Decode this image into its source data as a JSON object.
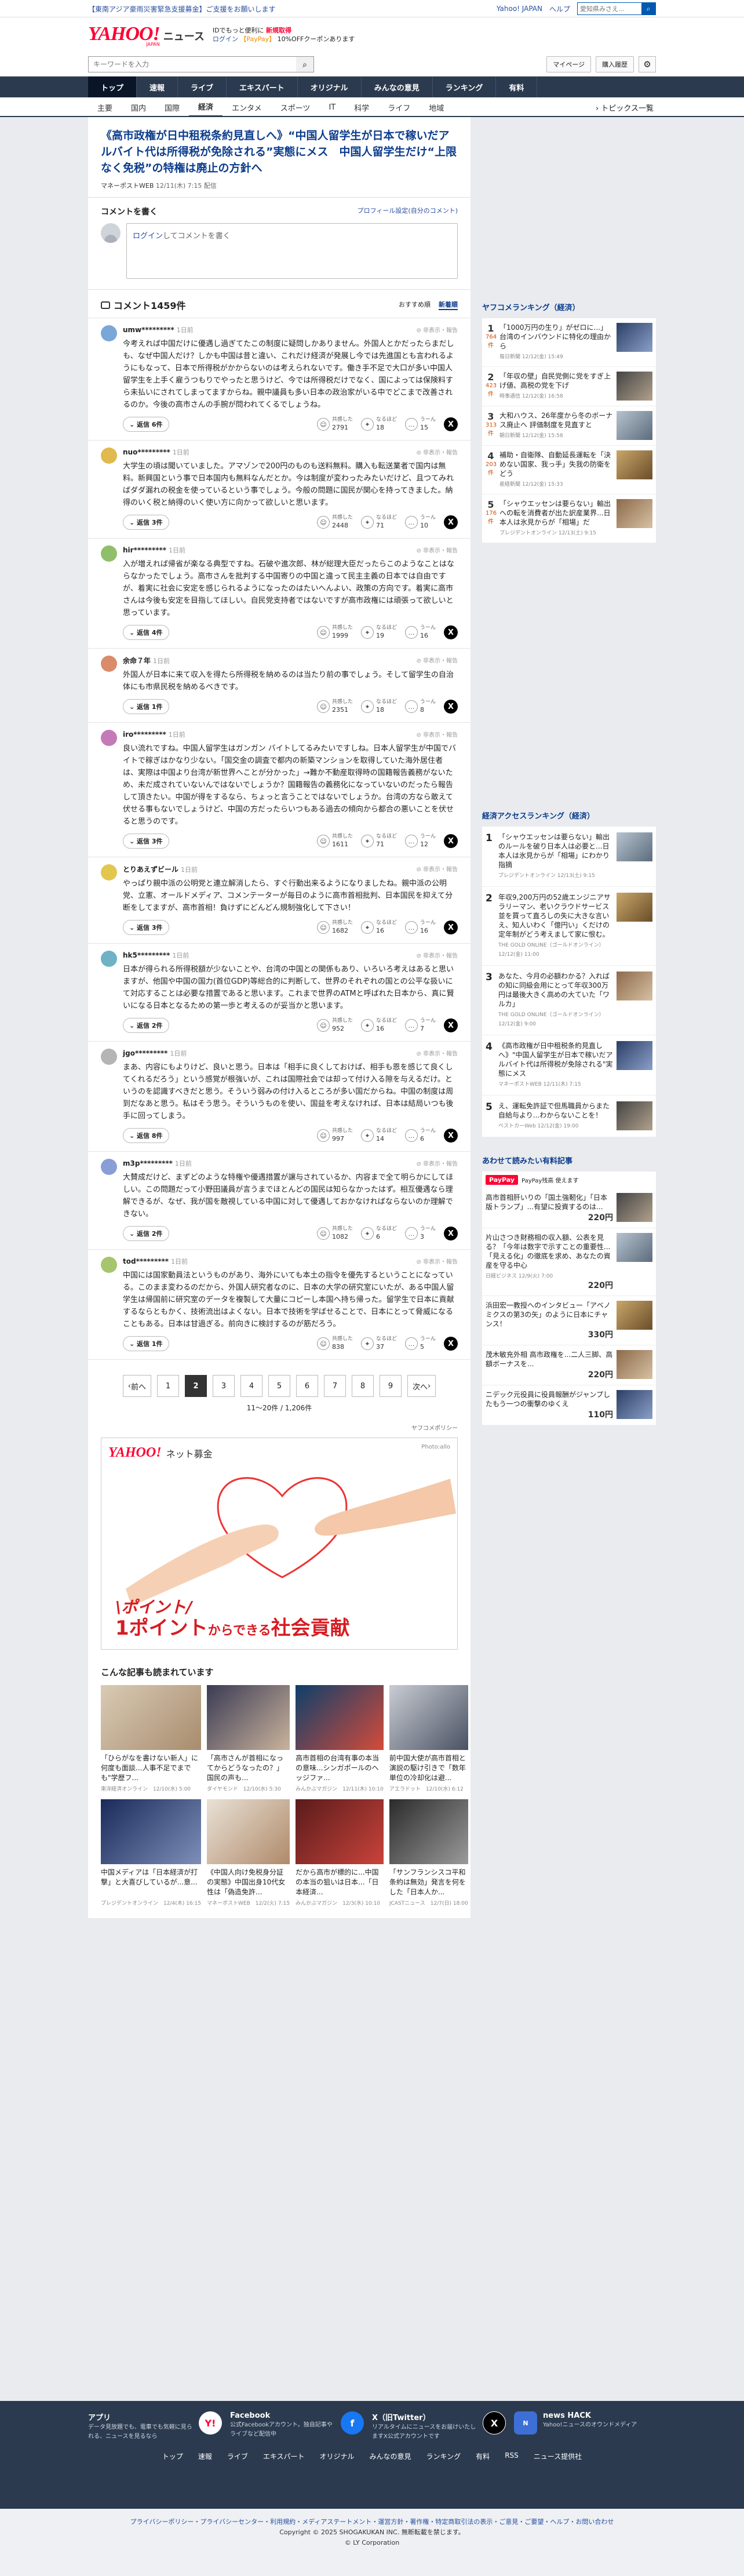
{
  "notice": {
    "text": "【東南アジア豪雨災害緊急支援募金】ご支援をお願いします",
    "links": [
      "Yahoo! JAPAN",
      "ヘルプ"
    ],
    "search_placeholder": "愛知県みさえ..."
  },
  "masthead": {
    "logo": "YAHOO!",
    "sub": "JAPAN",
    "news": "ニュース",
    "promo1": "IDでもっと便利に",
    "promo1b": "新規取得",
    "login": "ログイン",
    "pay": "【PayPay】",
    "promo2": "10%OFFクーポンあります"
  },
  "search": {
    "placeholder": "キーワードを入力",
    "mypage": "マイページ",
    "history": "購入履歴"
  },
  "gnav": [
    "トップ",
    "速報",
    "ライブ",
    "エキスパート",
    "オリジナル",
    "みんなの意見",
    "ランキング",
    "有料"
  ],
  "snav": [
    "主要",
    "国内",
    "国際",
    "経済",
    "エンタメ",
    "スポーツ",
    "IT",
    "科学",
    "ライフ",
    "地域"
  ],
  "snav_topics": "トピックス一覧",
  "article": {
    "title": "《高市政権が日中租税条約見直しへ》“中国人留学生が日本で稼いだアルバイト代は所得税が免除される”実態にメス　中国人留学生だけ“上限なく免税”の特権は廃止の方針へ",
    "source": "マネーポストWEB",
    "date": "12/11(木) 7:15 配信"
  },
  "post": {
    "title": "コメントを書く",
    "profile": "プロフィール設定(自分のコメント)",
    "login": "ログイン",
    "placeholder": "してコメントを書く"
  },
  "comments_head": {
    "title": "コメント1459件",
    "sort1": "おすすめ順",
    "sort2": "新着順"
  },
  "labels": {
    "react1": "共感した",
    "react2": "なるほど",
    "react3": "うーん",
    "control": "非表示・報告",
    "x": "X"
  },
  "comments": [
    {
      "user": "umw*********",
      "time": "1日前",
      "text": "今考えれば中国だけに優遇し過ぎてたこの制度に疑問しかありません。外国人とかだったらまだしも、なぜ中国人だけ？しかも中国は昔と違い、これだけ経済が発展し今では先進国とも言われるようにもなって、日本で所得税がかからないのは考えられないです。働き手不足で大口が多い中国人留学生を上手く雇うつもりでやったと思うけど、今では所得税だけでなく、国によっては保険料すら未払いにされてしまってますからね。親中議員も多い日本の政治家がいる中でどこまで改善されるのか。今後の高市さんの手腕が問われてくるでしょうね。",
      "replies": "返信 6件",
      "r1": "2791",
      "r2": "18",
      "r3": "15"
    },
    {
      "user": "nuo*********",
      "time": "1日前",
      "text": "大学生の頃は聞いていました。アマゾンで200円のものも送料無料。購入も転送業者で国内は無料。新興国という事で日本国内も無料なんだとか。今は制度が変わったみたいだけど、且つてみればダダ漏れの税金を使っているという事でしょう。今般の問題に国民が関心を持ってきました。納得のいく税と納得のいく使い方に向かって欲しいと思います。",
      "replies": "返信 3件",
      "r1": "2448",
      "r2": "71",
      "r3": "10"
    },
    {
      "user": "hir*********",
      "time": "1日前",
      "text": "入が増えれば帰省が楽なる典型ですね。石破や進次郎、林が総理大臣だったらこのようなことはならなかったでしょう。高市さんを批判する中国寄りの中国と違って民主主義の日本では自由ですが、着実に社会に安定を感じられるようになったのはたいへんよい、政策の方向です。着実に高市さんは今後も安定を目指してほしい。自民党支持者ではないですが高市政権には頑張って欲しいと思っています。",
      "replies": "返信 4件",
      "r1": "1999",
      "r2": "19",
      "r3": "16"
    },
    {
      "user": "余命７年",
      "time": "1日前",
      "text": "外国人が日本に来て収入を得たら所得税を納めるのは当たり前の事でしょう。そして留学生の自治体にも市県民税を納めるべきです。",
      "replies": "返信 1件",
      "r1": "2351",
      "r2": "18",
      "r3": "8"
    },
    {
      "user": "iro*********",
      "time": "1日前",
      "text": "良い流れですね。中国人留学生はガンガン バイトしてるみたいですしね。日本人留学生が中国でバイトで稼ぎはかなり少ない。「国交金の調査で都内の新築マンションを取得していた海外居住者は、実際は中国より台湾が新世界へことが分かった」→難か不動産取得時の国籍報告義務がないため、未だ成されていないんではないでしょうか？国籍報告の義務化になっていないのだったら報告して頂きたい。中国が得をするなら、ちょっと言うことではないでしょうか。台湾の方なら敢えて伏せる事もないでしょうけど、中国の方だったらいつもある過去の傾向から都合の悪いことを伏せると思うのです。",
      "replies": "返信 3件",
      "r1": "1611",
      "r2": "71",
      "r3": "12"
    },
    {
      "user": "とりあえずビール",
      "time": "1日前",
      "text": "やっぱり親中派の公明党と連立解消したら、すぐ行動出来るようになりましたね。親中派の公明党、立憲、オールドメディア、コメンテーターが毎日のように高市首相批判、日本国民を抑えて分断をしてますが、高市首相！負けずにどんどん規制強化して下さい！",
      "replies": "返信 3件",
      "r1": "1682",
      "r2": "16",
      "r3": "16"
    },
    {
      "user": "hk5*********",
      "time": "1日前",
      "text": "日本が得られる所得税額が少ないことや、台湾の中国との関係もあり、いろいろ考えはあると思いますが、他国や中国の国力(首位GDP)等総合的に判断して、世界のそれぞれの国との公平な扱いにて対応することは必要な措置であると思います。これまで世界のATMと呼ばれた日本から、真に賢いになる日本となるための第一歩と考えるのが妥当かと思います。",
      "replies": "返信 2件",
      "r1": "952",
      "r2": "16",
      "r3": "7"
    },
    {
      "user": "jgo*********",
      "time": "1日前",
      "text": "まあ、内容にもよりけど、良いと思う。日本は「相手に良くしておけば、相手も恩を感じて良くしてくれるだろう」という感覚が根強いが、これは国際社会では却って付け入る隙を与えるだけ。というのを認識すべきだと思う。そういう弱みの付け入るところが多い国だからね。中国の制度は周到だなあと思う。私はそう思う。そういうものを使い、国益を考えなければ、日本は結局いつも後手に回ってしまう。",
      "replies": "返信 8件",
      "r1": "997",
      "r2": "14",
      "r3": "6"
    },
    {
      "user": "m3p*********",
      "time": "1日前",
      "text": "大賛成だけど、まずどのような特権や優遇措置が譲与されているか、内容まで全て明らかにしてほしい。この問題だって小野田議員が言うまでほとんどの国民は知らなかったはず。相互優遇なら理解できるが、なぜ、我が国を敵視している中国に対して優遇しておかなければならないのか理解できない。",
      "replies": "返信 2件",
      "r1": "1082",
      "r2": "6",
      "r3": "3"
    },
    {
      "user": "tod*********",
      "time": "1日前",
      "text": "中国には国家動員法というものがあり、海外にいても本土の指令を優先するということになっている。このまま変わるのだから、外国人研究者なのに、日本の大学の研究室にいたが、ある中国人留学生は帰国前に研究室のデータを複製して大量にコピーし本国へ持ち帰った。留学生で日本に貢献するならともかく、技術流出はよくない。日本で技術を学ばせることで、日本にとって脅威になることもある。日本は甘過ぎる。前向きに検討するのが筋だろう。",
      "replies": "返信 1件",
      "r1": "838",
      "r2": "37",
      "r3": "5"
    }
  ],
  "pager": {
    "prev": "前へ",
    "pages": [
      "1",
      "2",
      "3",
      "4",
      "5",
      "6",
      "7",
      "8",
      "9"
    ],
    "next": "次へ",
    "count": "11〜20件 / 1,206件",
    "policy": "ヤフコメポリシー"
  },
  "ad": {
    "logo": "YAHOO!",
    "logo_sub": "JAPAN",
    "brand": "ネット募金",
    "photo": "Photo:allo",
    "line1": "\\ポイント/",
    "line2a": "1ポイント",
    "line2b": "からできる",
    "line2c": "社会貢献"
  },
  "related": {
    "title": "こんな記事も読まれています",
    "items": [
      {
        "text": "「ひらがなを書けない新人」に何度も面談...人事不足でまでも\"学歴フ...",
        "src": "東洋経済オンライン　12/10(水) 5:00"
      },
      {
        "text": "「高市さんが首相になってからどうなったの？」国民の声も...",
        "src": "ダイヤモンド　12/10(水) 5:30"
      },
      {
        "text": "高市首相の台湾有事の本当の意味...シンガポールのヘッジファ...",
        "src": "みんかぶマガジン　12/11(木) 10:10"
      },
      {
        "text": "前中国大使が高市首相と演説の駆け引きで「数年単位の冷却化は避...",
        "src": "アエラドット　12/10(水) 6:12"
      },
      {
        "text": "中国メディアは「日本経済が打撃」と大喜びしているが...意...",
        "src": "プレジデントオンライン　12/4(木) 16:15"
      },
      {
        "text": "《中国人向け免税身分証の実態》中国出身10代女性は「偽造免許...",
        "src": "マネーポストWEB　12/2(火) 7:15"
      },
      {
        "text": "だから高市が標的に...中国の本当の狙いは日本...「日本経済...",
        "src": "みんかぶマガジン　12/3(水) 10:10"
      },
      {
        "text": "「サンフランシスコ平和条約は無効」発言を何をした「日本人か...",
        "src": "JCASTニュース　12/7(日) 18:00"
      }
    ]
  },
  "side": {
    "ranking_title": "ヤフコメランキング（経済）",
    "ranking": [
      {
        "n": "1",
        "c": "764件",
        "text": "「1000万円の生り」がゼロに...」台湾のインバウンドに特化の理由から",
        "src": "毎日新聞 12/12(金) 15:49"
      },
      {
        "n": "2",
        "c": "423件",
        "text": "「年収の壁」自民党側に党をすぎ上げ値、高税の党を下げ",
        "src": "時事通信 12/12(金) 16:58"
      },
      {
        "n": "3",
        "c": "313件",
        "text": "大和ハウス、26年度から冬のボーナス廃止へ 評価制度を見直すと",
        "src": "朝日新聞 12/12(金) 15:58"
      },
      {
        "n": "4",
        "c": "203件",
        "text": "補助・自衛隊、自動延長運転を「決めない国家、我っ手」失我の防衛をどう",
        "src": "産経新聞 12/12(金) 15:33"
      },
      {
        "n": "5",
        "c": "176件",
        "text": "「シャウエッセンは要らない」輸出への転を消費者が出た訳産業界...日本人は氷見からが「相場」だ",
        "src": "プレジデントオンライン 12/13(土) 9:15"
      }
    ],
    "access_title": "経済アクセスランキング（経済）",
    "access": [
      {
        "n": "1",
        "text": "「シャウエッセンは要らない」輸出のルールを破り日本人は必要と...日本人は氷見からが「相場」にわかり指摘",
        "src": "プレジデントオンライン 12/13(土) 9:15"
      },
      {
        "n": "2",
        "text": "年収9,200万円の52歳エンジニアサラリーマン、老いクラウドサービス並を買って直ろしの失に大きな言いえ、知人いわく「億円い」くだけの定年制がどう考えまして家に恨む。",
        "src": "THE GOLD ONLINE（ゴールドオンライン）12/12(金) 11:00"
      },
      {
        "n": "3",
        "text": "あなた、今月の必額わかる？入ればの知に同級会用にとって年収300万円は最後大きく高めの大ていた「ワルカ」",
        "src": "THE GOLD ONLINE（ゴールドオンライン）12/12(金) 9:00"
      },
      {
        "n": "4",
        "text": "《高市政権が日中租税条約見直しへ》\"中国人留学生が日本で稼いだアルバイト代は所得税が免除される\"実態にメス",
        "src": "マネーポストWEB 12/11(木) 7:15"
      },
      {
        "n": "5",
        "text": "え、運転免許証で但馬職員からまた自給与より...わからないことを！",
        "src": "ベストカーWeb 12/12(金) 19:00"
      }
    ],
    "pay_title": "あわせて読みたい有料記事",
    "pay_badge": "PayPay",
    "pay_sub": "PayPay残高 使えます",
    "pay": [
      {
        "text": "高市首相肝いりの「国土強靭化」「日本版トランプ」...有望に投資するのは...",
        "src": "",
        "price": "220円"
      },
      {
        "text": "片山さつき財務相の収入額、公表を見る？「今年は数字で示すことの重要性...「見える化」の徹底を求め、あなたの資産を守る中心",
        "src": "日経ビジネス 12/9(火) 7:00",
        "price": "220円"
      },
      {
        "text": "浜田宏一教授へのインタビュー「アベノミクスの第3の矢」のように日本にチャンス！",
        "src": "",
        "price": "330円"
      },
      {
        "text": "茂木敏充外相 高市政権を...二人三脚、高額ボーナスを...",
        "src": "",
        "price": "220円"
      },
      {
        "text": "ニデック元役員に役員報酬がジャンプしたもう一つの衝撃のゆくえ",
        "src": "",
        "price": "110円"
      }
    ]
  },
  "footer": {
    "social": [
      {
        "title": "アプリ",
        "text": "データ見放題でも、電車でも気軽に見られる、ニュースを見るなら"
      },
      {
        "title": "Facebook",
        "text": "公式Facebookアカウント。独自記事やライブなど配信中"
      },
      {
        "title": "X（旧Twitter）",
        "text": "リアルタイムにニュースをお届けいたしますX公式アカウントです"
      },
      {
        "title": "news HACK",
        "text": "Yahoo!ニュースのオウンドメディア"
      }
    ],
    "nav": [
      "トップ",
      "速報",
      "ライブ",
      "エキスパート",
      "オリジナル",
      "みんなの意見",
      "ランキング",
      "有料",
      "RSS",
      "ニュース提供社"
    ],
    "links": "プライバシーポリシー・プライバシーセンター・利用規約・メディアステートメント・運営方針・著作権・特定商取引法の表示・ご意見・ご要望・ヘルプ・お問い合わせ",
    "copyright": "Copyright © 2025 SHOGAKUKAN INC. 無断転載を禁じます。",
    "corp": "© LY Corporation"
  }
}
